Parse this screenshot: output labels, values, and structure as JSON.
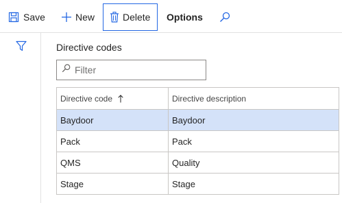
{
  "toolbar": {
    "save_label": "Save",
    "new_label": "New",
    "delete_label": "Delete",
    "options_label": "Options",
    "accent_color": "#2266e3"
  },
  "page": {
    "title": "Directive codes"
  },
  "filter": {
    "placeholder": "Filter",
    "value": ""
  },
  "grid": {
    "columns": [
      "Directive code",
      "Directive description"
    ],
    "sort": {
      "column": "Directive code",
      "direction": "ascending"
    },
    "selected_row": 0,
    "selected_color": "#d4e2f9",
    "rows": [
      {
        "code": "Baydoor",
        "description": "Baydoor"
      },
      {
        "code": "Pack",
        "description": "Pack"
      },
      {
        "code": "QMS",
        "description": "Quality"
      },
      {
        "code": "Stage",
        "description": "Stage"
      }
    ]
  },
  "icons": {
    "save": "save-icon",
    "new": "plus-icon",
    "delete": "trash-icon",
    "search": "search-icon",
    "filter_pane": "funnel-icon",
    "filter_box": "search-icon",
    "sort": "arrow-up-icon"
  }
}
